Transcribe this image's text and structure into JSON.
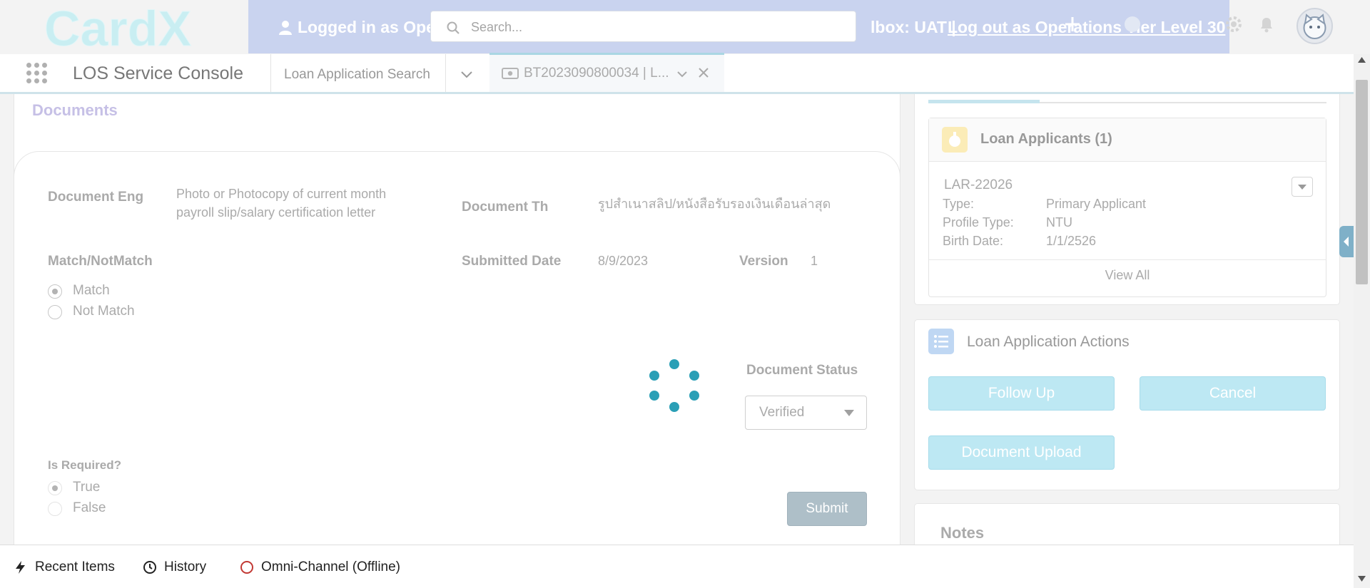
{
  "global_header": {
    "logo_text": "CardX",
    "impersonation": {
      "logged_in_text": "Logged in as Ope",
      "sandbox_text": "lbox: UAT |",
      "logout_text": "Log out as Operations Tier Level 30"
    },
    "search": {
      "placeholder": "Search..."
    },
    "icons": [
      "add-icon",
      "help-icon",
      "settings-icon",
      "notification-icon",
      "avatar"
    ]
  },
  "nav": {
    "app_name": "LOS Service Console",
    "tabs": [
      {
        "label": "Loan Application Search"
      },
      {
        "label": "BT2023090800034 | L..."
      }
    ]
  },
  "document": {
    "section_title": "Documents",
    "fields": {
      "doc_eng_label": "Document Eng",
      "doc_eng_value": "Photo or Photocopy of current month payroll slip/salary certification letter",
      "doc_th_label": "Document Th",
      "doc_th_value": "รูปสำเนาสลิป/หนังสือรับรองเงินเดือนล่าสุด",
      "match_label": "Match/NotMatch",
      "match_options": [
        "Match",
        "Not Match"
      ],
      "match_selected": "Match",
      "submitted_label": "Submitted Date",
      "submitted_value": "8/9/2023",
      "version_label": "Version",
      "version_value": "1",
      "required_label": "Is Required?",
      "required_options": [
        "True",
        "False"
      ],
      "required_selected": "True",
      "status_label": "Document Status",
      "status_value": "Verified"
    },
    "submit_label": "Submit"
  },
  "right_panel": {
    "applicants": {
      "title": "Loan Applicants (1)",
      "record": {
        "name": "LAR-22026",
        "rows": [
          {
            "label": "Type:",
            "value": "Primary Applicant"
          },
          {
            "label": "Profile Type:",
            "value": "NTU"
          },
          {
            "label": "Birth Date:",
            "value": "1/1/2526"
          }
        ]
      },
      "view_all": "View All"
    },
    "actions": {
      "title": "Loan Application Actions",
      "buttons": [
        "Follow Up",
        "Cancel",
        "Document Upload"
      ]
    },
    "notes": {
      "title": "Notes"
    }
  },
  "utility_bar": {
    "items": [
      {
        "label": "Recent Items",
        "icon": "lightning-icon"
      },
      {
        "label": "History",
        "icon": "clock-icon"
      },
      {
        "label": "Omni-Channel (Offline)",
        "icon": "offline-status-icon"
      }
    ]
  },
  "colors": {
    "spinner": "#2a9fb6",
    "action_button": "#bde8f3",
    "banner": "#c9d3ef",
    "offline_status": "#c23934"
  }
}
